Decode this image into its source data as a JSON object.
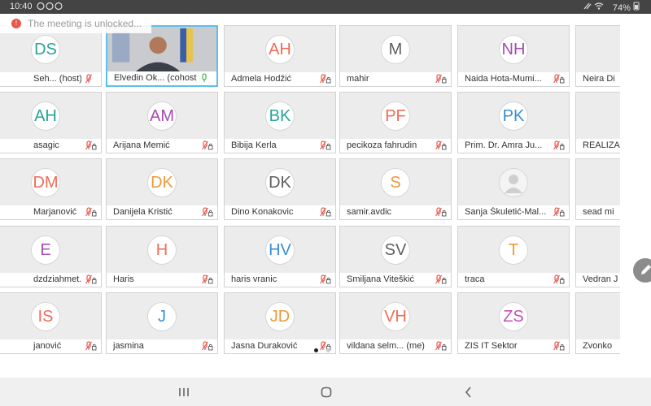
{
  "status_bar": {
    "time": "10:40",
    "battery": "74%"
  },
  "banner": {
    "text": "The meeting is unlocked..."
  },
  "colors": {
    "salmon": "#ef6d57",
    "purple": "#a84bb4",
    "teal": "#27a39a",
    "orange": "#ef9a39",
    "pink": "#e35a78",
    "blue": "#3a8fcf",
    "gray": "#5f5f5f",
    "lavender": "#8f57c4",
    "magenta": "#c451b6",
    "tile_bg": "#ececec",
    "active_border": "#5cc0ea",
    "mic_muted": "#e8594c",
    "mic_on": "#3dbb4f"
  },
  "participants": [
    {
      "name": "Seh... (host)",
      "initials": "DS",
      "color": "teal",
      "mic": "muted-only"
    },
    {
      "name": "Elvedin Ok... (cohost)",
      "initials": "",
      "color": "",
      "mic": "on",
      "video": true,
      "active": true
    },
    {
      "name": "Admela Hodžić",
      "initials": "AH",
      "color": "salmon",
      "mic": "muted"
    },
    {
      "name": "mahir",
      "initials": "M",
      "color": "gray",
      "mic": "muted"
    },
    {
      "name": "Naida Hota-Mumi...",
      "initials": "NH",
      "color": "purple",
      "mic": "muted"
    },
    {
      "name": "Neira Di",
      "initials": "",
      "color": "gray",
      "mic": "none"
    },
    {
      "name": "asagic",
      "initials": "AH",
      "color": "teal",
      "mic": "muted"
    },
    {
      "name": "Arijana Memić",
      "initials": "AM",
      "color": "purple",
      "mic": "muted"
    },
    {
      "name": "Bibija Kerla",
      "initials": "BK",
      "color": "teal",
      "mic": "muted"
    },
    {
      "name": "pecikoza fahrudin",
      "initials": "PF",
      "color": "salmon",
      "mic": "muted"
    },
    {
      "name": "Prim. Dr. Amra Ju...",
      "initials": "PK",
      "color": "blue",
      "mic": "muted"
    },
    {
      "name": "REALIZA",
      "initials": "",
      "color": "gray",
      "mic": "none"
    },
    {
      "name": "Marjanović",
      "initials": "DM",
      "color": "salmon",
      "mic": "muted"
    },
    {
      "name": "Danijela Kristić",
      "initials": "DK",
      "color": "orange",
      "mic": "muted"
    },
    {
      "name": "Dino Konakovic",
      "initials": "DK",
      "color": "gray",
      "mic": "muted"
    },
    {
      "name": "samir.avdic",
      "initials": "S",
      "color": "orange",
      "mic": "muted"
    },
    {
      "name": "Sanja Škuletić-Mal...",
      "initials": "",
      "color": "gray",
      "mic": "muted",
      "generic": true
    },
    {
      "name": "sead mi",
      "initials": "",
      "color": "gray",
      "mic": "none"
    },
    {
      "name": "dzdziahmet...",
      "initials": "E",
      "color": "purple",
      "mic": "muted"
    },
    {
      "name": "Haris",
      "initials": "H",
      "color": "salmon",
      "mic": "muted"
    },
    {
      "name": "haris vranic",
      "initials": "HV",
      "color": "blue",
      "mic": "muted"
    },
    {
      "name": "Smiljana Viteškić",
      "initials": "SV",
      "color": "gray",
      "mic": "muted"
    },
    {
      "name": "traca",
      "initials": "T",
      "color": "orange",
      "mic": "muted"
    },
    {
      "name": "Vedran J",
      "initials": "",
      "color": "gray",
      "mic": "none"
    },
    {
      "name": "janović",
      "initials": "IS",
      "color": "salmon",
      "mic": "muted"
    },
    {
      "name": "jasmina",
      "initials": "J",
      "color": "blue",
      "mic": "muted"
    },
    {
      "name": "Jasna Duraković",
      "initials": "JD",
      "color": "orange",
      "mic": "muted"
    },
    {
      "name": "vildana selm... (me)",
      "initials": "VH",
      "color": "salmon",
      "mic": "muted"
    },
    {
      "name": "ZIS IT Sektor",
      "initials": "ZS",
      "color": "magenta",
      "mic": "muted"
    },
    {
      "name": "Zvonko",
      "initials": "",
      "color": "gray",
      "mic": "none"
    }
  ],
  "pagination": {
    "total": 2,
    "current": 1
  }
}
